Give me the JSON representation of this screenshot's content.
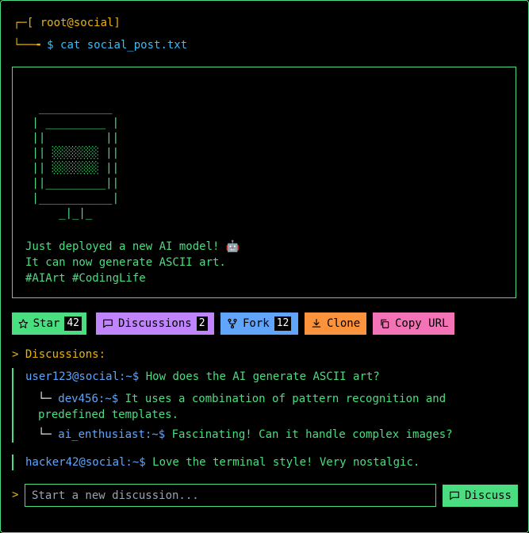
{
  "terminal": {
    "header": "┌─[ root@social]",
    "command_prefix": "└──╼ ",
    "command": "$ cat social_post.txt"
  },
  "post": {
    "ascii_art": "  ___________\n | _________ |\n ||         ||\n || ░░░░░░░ ||\n || ░░░░░░░ ||\n ||_________||\n |___________|\n     _|_|_",
    "lines": [
      "Just deployed a new AI model! 🤖",
      "It can now generate ASCII art.",
      "#AIArt #CodingLife"
    ]
  },
  "actions": {
    "star": {
      "label": "Star",
      "count": "42",
      "color": "#4ade80"
    },
    "discussions": {
      "label": "Discussions",
      "count": "2",
      "color": "#c084fc"
    },
    "fork": {
      "label": "Fork",
      "count": "12",
      "color": "#60a5fa"
    },
    "clone": {
      "label": "Clone",
      "color": "#fb923c"
    },
    "copy_url": {
      "label": "Copy URL",
      "color": "#f472b6"
    }
  },
  "discussions": {
    "title": "> Discussions:",
    "threads": [
      {
        "user": "user123@social:~$",
        "text": " How does the AI generate ASCII art?",
        "replies": [
          {
            "branch": "└─ ",
            "user": "dev456:~$",
            "text": " It uses a combination of pattern recognition and",
            "text_cont": "predefined templates."
          },
          {
            "branch": "└─ ",
            "user": "ai_enthusiast:~$",
            "text": " Fascinating! Can it handle complex images?"
          }
        ]
      },
      {
        "user": "hacker42@social:~$",
        "text": " Love the terminal style! Very nostalgic."
      }
    ]
  },
  "new_discussion": {
    "prompt": ">",
    "placeholder": "Start a new discussion...",
    "button_label": "Discuss"
  }
}
